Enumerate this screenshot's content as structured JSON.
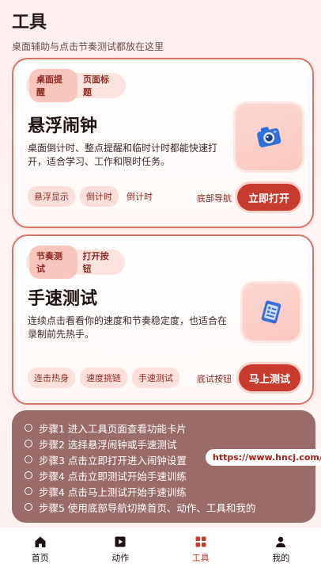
{
  "header": {
    "title": "工具",
    "subtitle": "桌面辅助与点击节奏测试都放在这里"
  },
  "card_alarm": {
    "tab_active": "桌面提醒",
    "tab_plain": "页面标题",
    "title": "悬浮闹钟",
    "description": "桌面倒计时、整点提醒和临时计时都能快速打开，适合学习、工作和限时任务。",
    "tags": [
      "悬浮显示",
      "倒计时"
    ],
    "tag_plain": "倒计时",
    "nav_hint": "底部导航",
    "cta": "立即打开",
    "icon": "camera-icon"
  },
  "card_speed": {
    "tab_active": "节奏测试",
    "tab_plain": "打开按钮",
    "title": "手速测试",
    "description": "连续点击看看你的速度和节奏稳定度，也适合在录制前先热手。",
    "tags": [
      "连击热身",
      "速度挑链",
      "手速测试"
    ],
    "nav_hint": "底试按钮",
    "cta": "马上测试",
    "icon": "checklist-icon"
  },
  "steps": [
    "步骤1 进入工具页面查看功能卡片",
    "步骤2 选择悬浮闹钟或手速测试",
    "步骤3 点击立即打开进入闹钟设置",
    "步骤4 点击立即测试开始手速训练",
    "步骤4 点击马上测试开始手速训练",
    "步骤5 使用底部导航切换首页、动作、工具和我的"
  ],
  "url_badge": "https://www.hncj.com/",
  "tabbar": [
    {
      "label": "首页",
      "icon": "home-icon"
    },
    {
      "label": "动作",
      "icon": "play-icon"
    },
    {
      "label": "工具",
      "icon": "grid-icon",
      "active": true
    },
    {
      "label": "我的",
      "icon": "person-icon"
    }
  ],
  "colors": {
    "accent": "#c83a2c",
    "border": "#d8746a",
    "steps_bg": "#9a6b68"
  }
}
